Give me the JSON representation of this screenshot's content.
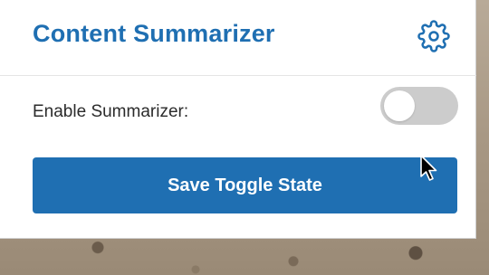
{
  "popup": {
    "title": "Content Summarizer",
    "settings_icon": "gear-icon",
    "toggle_label": "Enable Summarizer:",
    "toggle_state": "off",
    "save_label": "Save Toggle State"
  },
  "colors": {
    "accent": "#1f6fb2",
    "toggle_off": "#cccccc"
  }
}
